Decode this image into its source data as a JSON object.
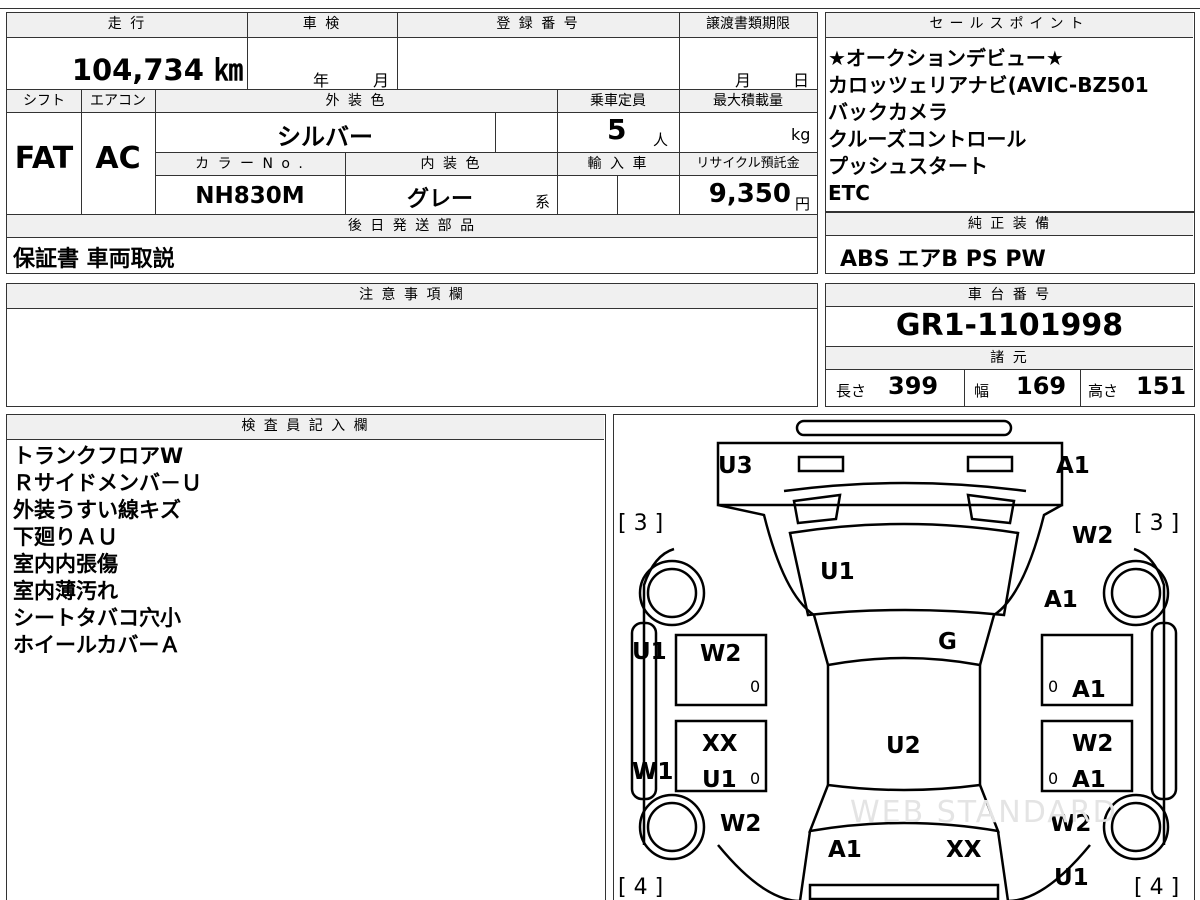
{
  "labels": {
    "mileage": "走 行",
    "inspection": "車 検",
    "registration": "登 録 番 号",
    "transfer_deadline": "譲渡書類期限",
    "sales_points": "セールスポイント",
    "shift": "シフト",
    "aircon": "エアコン",
    "exterior_color": "外 装 色",
    "capacity": "乗車定員",
    "max_load": "最大積載量",
    "color_no": "カ ラ ー N o .",
    "interior_color": "内 装 色",
    "import": "輸 入 車",
    "recycle": "リサイクル預託金",
    "later_parts": "後 日 発 送 部 品",
    "genuine": "純 正 装 備",
    "notes": "注 意 事 項 欄",
    "chassis": "車 台 番 号",
    "specs": "諸 元",
    "inspector": "検 査 員 記 入 欄",
    "year": "年",
    "month": "月",
    "month2": "月",
    "day": "日",
    "person": "人",
    "kg": "kg",
    "yen": "円",
    "kei": "系",
    "length": "長さ",
    "width": "幅",
    "height": "高さ"
  },
  "vehicle": {
    "mileage": "104,734 ㎞",
    "shift": "FAT",
    "aircon": "AC",
    "exterior_color": "シルバー",
    "capacity": "5",
    "color_no": "NH830M",
    "interior_color": "グレー",
    "recycle_fee": "9,350",
    "later_parts": "保証書 車両取説",
    "genuine_equipment": "ABS エアB PS PW",
    "chassis_no": "GR1-1101998",
    "length": "399",
    "width": "169",
    "height": "151"
  },
  "sales_points": [
    "★オークションデビュー★",
    "カロッツェリアナビ(AVIC-BZ501",
    "バックカメラ",
    "クルーズコントロール",
    "プッシュスタート",
    "ETC"
  ],
  "inspector_notes": [
    "トランクフロアW",
    "Ｒサイドメンバ－Ｕ",
    "外装うすい線キズ",
    "下廻りＡＵ",
    "室内内張傷",
    "室内薄汚れ",
    "シートタバコ穴小",
    "ホイールカバーＡ"
  ],
  "diagram": {
    "marks": [
      "U3",
      "A1",
      "U1",
      "W2",
      "A1",
      "G",
      "U1",
      "W2",
      "0",
      "0",
      "A1",
      "XX",
      "U2",
      "W2",
      "W1",
      "U1",
      "0",
      "0",
      "A1",
      "W2",
      "W2",
      "A1",
      "XX",
      "U1"
    ],
    "brackets": [
      "[ 3 ]",
      "[ 3 ]",
      "[ 4 ]",
      "[ 4 ]"
    ],
    "watermark": "WEB STANDARD"
  }
}
